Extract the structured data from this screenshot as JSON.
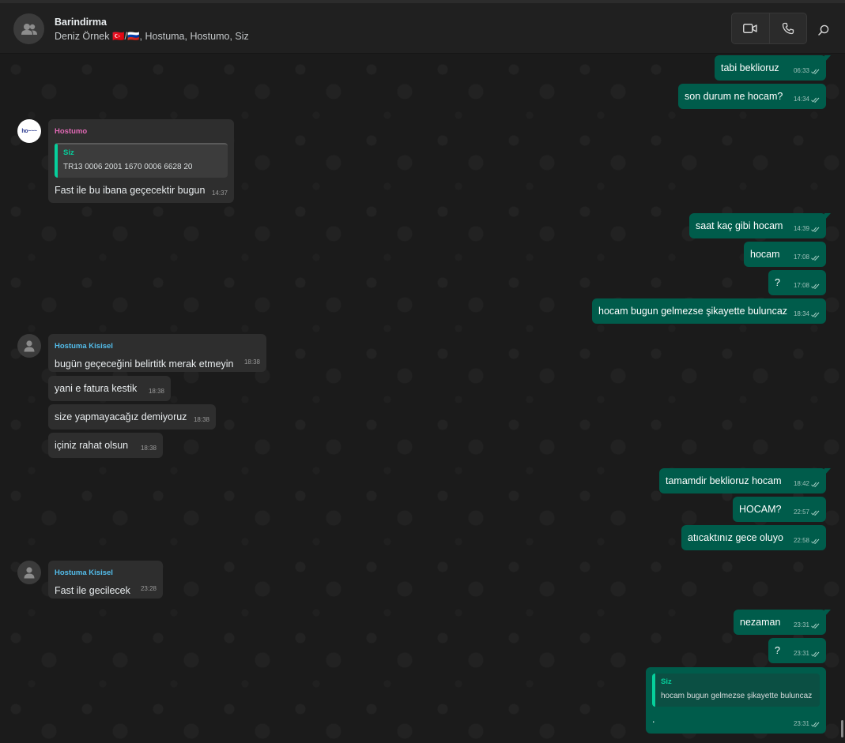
{
  "header": {
    "title": "Barindirma",
    "members": "Deniz Örnek 🇹🇷/🇷🇺, Hostuma, Hostumo, Siz"
  },
  "messages": [
    {
      "id": "m1",
      "dir": "out",
      "text": "tabi beklioruz",
      "time": "06:33"
    },
    {
      "id": "m2",
      "dir": "out",
      "text": "son durum ne hocam?",
      "time": "14:34"
    },
    {
      "id": "m3",
      "dir": "in",
      "sender": "Hostumo",
      "quote_name": "Siz",
      "quote_text": "TR13 0006 2001 1670 0006 6628 20",
      "text": "Fast ile bu ibana geçecektir bugun",
      "time": "14:37"
    },
    {
      "id": "m4",
      "dir": "out",
      "text": "saat kaç gibi hocam",
      "time": "14:39"
    },
    {
      "id": "m5",
      "dir": "out",
      "text": "hocam",
      "time": "17:08"
    },
    {
      "id": "m6",
      "dir": "out",
      "text": "?",
      "time": "17:08"
    },
    {
      "id": "m7",
      "dir": "out",
      "text": "hocam bugun gelmezse şikayette buluncaz",
      "time": "18:34"
    },
    {
      "id": "m8",
      "dir": "in",
      "sender": "Hostuma Kisisel",
      "text": "bugün geçeceğini belirtitk merak etmeyin",
      "time": "18:38"
    },
    {
      "id": "m9",
      "dir": "in",
      "text": "yani e fatura kestik",
      "time": "18:38"
    },
    {
      "id": "m10",
      "dir": "in",
      "text": "size yapmayacağız demiyoruz",
      "time": "18:38"
    },
    {
      "id": "m11",
      "dir": "in",
      "text": "içiniz rahat olsun",
      "time": "18:38"
    },
    {
      "id": "m12",
      "dir": "out",
      "text": "tamamdir beklioruz hocam",
      "time": "18:42"
    },
    {
      "id": "m13",
      "dir": "out",
      "text": "HOCAM?",
      "time": "22:57"
    },
    {
      "id": "m14",
      "dir": "out",
      "text": "atıcaktınız gece oluyo",
      "time": "22:58"
    },
    {
      "id": "m15",
      "dir": "in",
      "sender": "Hostuma Kisisel",
      "text": "Fast ile gecilecek",
      "time": "23:28"
    },
    {
      "id": "m16",
      "dir": "out",
      "text": "nezaman",
      "time": "23:31"
    },
    {
      "id": "m17",
      "dir": "out",
      "text": "?",
      "time": "23:31"
    },
    {
      "id": "m18",
      "dir": "out",
      "quote_name": "Siz",
      "quote_text": "hocam bugun gelmezse şikayette buluncaz",
      "text": ".",
      "time": "23:31"
    }
  ],
  "colors": {
    "outgoing_bubble": "#005c4b",
    "incoming_bubble": "#2e2e2e",
    "sender_hostumo": "#e26ab6",
    "sender_hostuma": "#53bdeb",
    "quote_accent": "#06cf9c"
  }
}
